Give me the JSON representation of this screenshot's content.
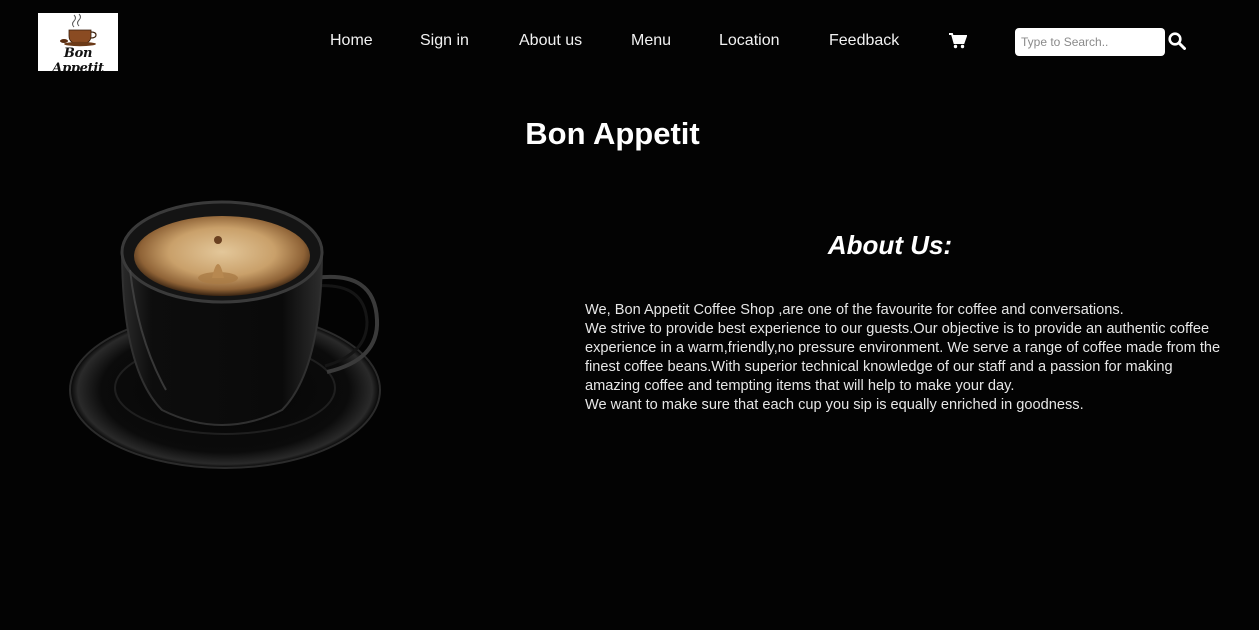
{
  "brand": {
    "logo_text": "Bon Appetit",
    "logo_icon": "coffee-cup-icon"
  },
  "nav": {
    "items": [
      {
        "label": "Home"
      },
      {
        "label": "Sign in"
      },
      {
        "label": "About us"
      },
      {
        "label": "Menu"
      },
      {
        "label": "Location"
      },
      {
        "label": "Feedback"
      }
    ],
    "cart_icon": "shopping-cart-icon"
  },
  "search": {
    "placeholder": "Type to Search..",
    "value": "",
    "icon": "search-icon"
  },
  "main": {
    "title": "Bon Appetit",
    "image_icon": "espresso-cup-image",
    "about": {
      "heading": "About Us:",
      "lines": [
        "We, Bon Appetit Coffee Shop ,are one of the favourite for coffee and conversations.",
        "We strive to provide best experience to our guests.Our objective is to provide an authentic coffee experience in a warm,friendly,no pressure environment. We serve a range of coffee made from the finest coffee beans.With superior technical knowledge of our staff and a passion for making amazing coffee and tempting items that will help to make your day.",
        "We want to make sure that each cup you sip is equally enriched in goodness."
      ]
    }
  },
  "colors": {
    "background": "#030303",
    "text": "#ffffff",
    "search_bg": "#ffffff"
  }
}
